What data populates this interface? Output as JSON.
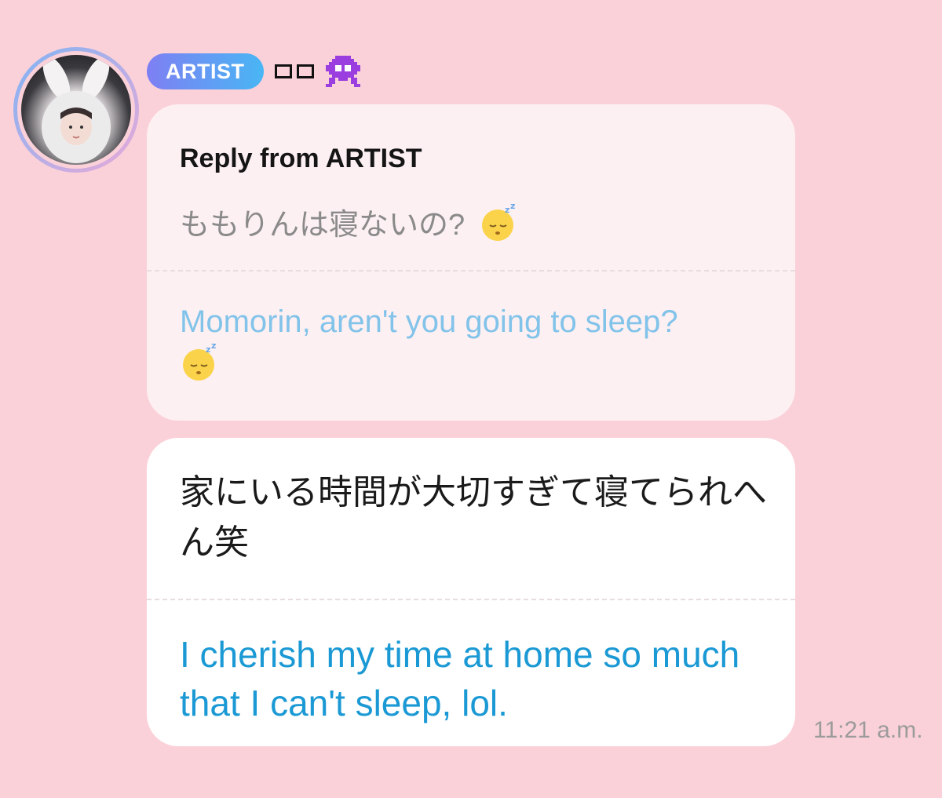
{
  "sender": {
    "badge_label": "ARTIST",
    "name": "□□",
    "name_icon": "alien-monster-icon",
    "avatar": "avatar-photo"
  },
  "reply": {
    "title": "Reply from ARTIST",
    "original_text": "ももりんは寝ないの?",
    "translation": "Momorin, aren't you going to sleep?",
    "emoji": "sleeping-face-icon"
  },
  "message": {
    "original_text": "家にいる時間が大切すぎて寝てられへん笑",
    "translation": "I cherish my time at home so much that I can't sleep, lol."
  },
  "timestamp": "11:21 a.m.",
  "colors": {
    "background": "#fbd1d9",
    "badge_gradient_start": "#7e7ff3",
    "badge_gradient_end": "#49b6f4",
    "reply_bubble": "#fdf0f2",
    "reply_translation": "#82c3ea",
    "message_translation": "#1b99d4"
  }
}
